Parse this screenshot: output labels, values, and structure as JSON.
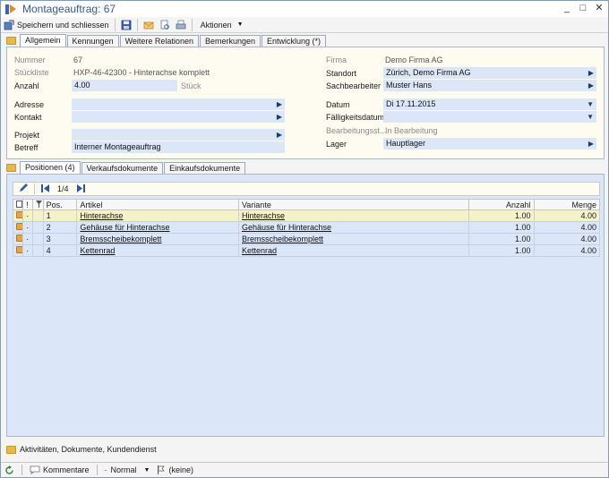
{
  "window": {
    "title": "Montageauftrag: 67",
    "controls": [
      "_",
      "□",
      "✕"
    ]
  },
  "toolbar": {
    "save_close_label": "Speichern und schliessen",
    "actions_label": "Aktionen"
  },
  "top_tabs": [
    {
      "label": "Allgemein",
      "active": true
    },
    {
      "label": "Kennungen",
      "active": false
    },
    {
      "label": "Weitere Relationen",
      "active": false
    },
    {
      "label": "Bemerkungen",
      "active": false
    },
    {
      "label": "Entwicklung (*)",
      "active": false
    }
  ],
  "form": {
    "left": {
      "nummer_label": "Nummer",
      "nummer_value": "67",
      "stueckliste_label": "Stückliste",
      "stueckliste_value": "HXP-46-42300  -  Hinterachse komplett",
      "anzahl_label": "Anzahl",
      "anzahl_value": "4.00",
      "anzahl_unit": "Stück",
      "adresse_label": "Adresse",
      "adresse_value": "",
      "kontakt_label": "Kontakt",
      "kontakt_value": "",
      "projekt_label": "Projekt",
      "projekt_value": "",
      "betreff_label": "Betreff",
      "betreff_value": "Interner Montageauftrag"
    },
    "right": {
      "firma_label": "Firma",
      "firma_value": "Demo Firma AG",
      "standort_label": "Standort",
      "standort_value": "Zürich, Demo Firma AG",
      "sachbearbeiter_label": "Sachbearbeiter",
      "sachbearbeiter_value": "Muster Hans",
      "datum_label": "Datum",
      "datum_value": "Di 17.11.2015",
      "faelligkeit_label": "Fälligkeitsdatum",
      "faelligkeit_value": "",
      "bearbeitung_label": "Bearbeitungsst...",
      "bearbeitung_value": "In Bearbeitung",
      "lager_label": "Lager",
      "lager_value": "Hauptlager"
    }
  },
  "bottom_tabs": [
    {
      "label": "Positionen (4)",
      "active": true
    },
    {
      "label": "Verkaufsdokumente",
      "active": false
    },
    {
      "label": "Einkaufsdokumente",
      "active": false
    }
  ],
  "positions": {
    "pager": "1/4",
    "columns": {
      "pos": "Pos.",
      "artikel": "Artikel",
      "variante": "Variante",
      "anzahl": "Anzahl",
      "menge": "Menge"
    },
    "rows": [
      {
        "pos": "1",
        "artikel": "Hinterachse",
        "variante": "Hinterachse",
        "anzahl": "1.00",
        "menge": "4.00",
        "selected": true
      },
      {
        "pos": "2",
        "artikel": "Gehäuse für Hinterachse",
        "variante": "Gehäuse für Hinterachse",
        "anzahl": "1.00",
        "menge": "4.00",
        "selected": false
      },
      {
        "pos": "3",
        "artikel": "Bremsscheibekomplett",
        "variante": "Bremsscheibekomplett",
        "anzahl": "1.00",
        "menge": "4.00",
        "selected": false
      },
      {
        "pos": "4",
        "artikel": "Kettenrad",
        "variante": "Kettenrad",
        "anzahl": "1.00",
        "menge": "4.00",
        "selected": false
      }
    ]
  },
  "activities_label": "Aktivitäten, Dokumente, Kundendienst",
  "statusbar": {
    "comments_label": "Kommentare",
    "priority_label": "Normal",
    "flag_label": "(keine)"
  }
}
